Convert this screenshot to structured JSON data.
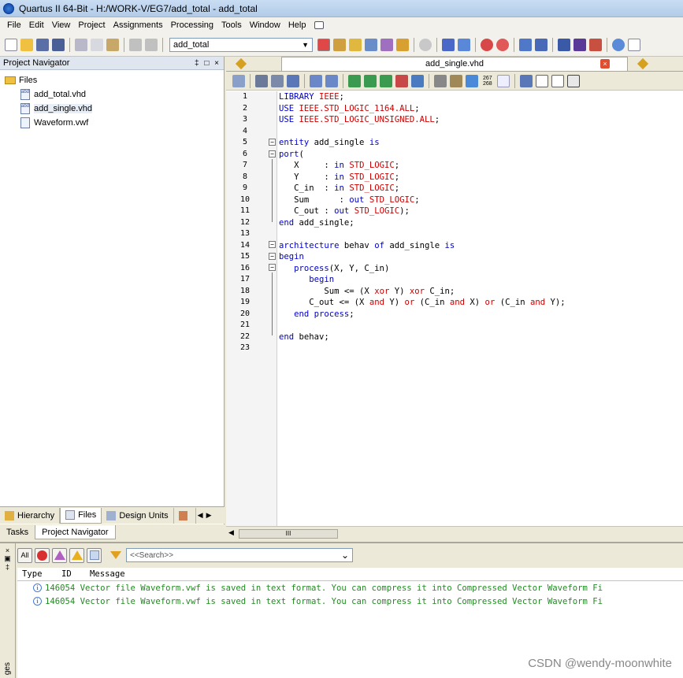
{
  "window": {
    "title": "Quartus II 64-Bit - H:/WORK-V/EG7/add_total - add_total"
  },
  "menu": [
    "File",
    "Edit",
    "View",
    "Project",
    "Assignments",
    "Processing",
    "Tools",
    "Window",
    "Help"
  ],
  "toolbar": {
    "entity_value": "add_total"
  },
  "navigator": {
    "title": "Project Navigator",
    "controls": "‡ □ ×",
    "folder": "Files",
    "files": [
      "add_total.vhd",
      "add_single.vhd",
      "Waveform.vwf"
    ],
    "file_icons": [
      "abd",
      "abd",
      ""
    ],
    "tabs": [
      "Hierarchy",
      "Files",
      "Design Units"
    ],
    "bottom_tabs": [
      "Tasks",
      "Project Navigator"
    ]
  },
  "editor": {
    "tab_label": "add_single.vhd",
    "counter_top": "267",
    "counter_bottom": "268",
    "line_numbers": [
      "1",
      "2",
      "3",
      "4",
      "5",
      "6",
      "7",
      "8",
      "9",
      "10",
      "11",
      "12",
      "13",
      "14",
      "15",
      "16",
      "17",
      "18",
      "19",
      "20",
      "21",
      "22",
      "23"
    ],
    "scroll_marker": "III"
  },
  "code": [
    [
      {
        "t": "LIBRARY ",
        "c": "kw"
      },
      {
        "t": "IEEE",
        "c": "rd"
      },
      {
        "t": ";",
        "c": ""
      }
    ],
    [
      {
        "t": "USE ",
        "c": "kw"
      },
      {
        "t": "IEEE.STD_LOGIC_1164.ALL",
        "c": "rd"
      },
      {
        "t": ";",
        "c": ""
      }
    ],
    [
      {
        "t": "USE ",
        "c": "kw"
      },
      {
        "t": "IEEE.STD_LOGIC_UNSIGNED.ALL",
        "c": "rd"
      },
      {
        "t": ";",
        "c": ""
      }
    ],
    [],
    [
      {
        "t": "entity ",
        "c": "kw"
      },
      {
        "t": "add_single ",
        "c": ""
      },
      {
        "t": "is",
        "c": "kw"
      }
    ],
    [
      {
        "t": "port",
        "c": "kw"
      },
      {
        "t": "(",
        "c": ""
      }
    ],
    [
      {
        "t": "   X     : ",
        "c": ""
      },
      {
        "t": "in ",
        "c": "kw"
      },
      {
        "t": "STD_LOGIC",
        "c": "rd"
      },
      {
        "t": ";",
        "c": ""
      }
    ],
    [
      {
        "t": "   Y     : ",
        "c": ""
      },
      {
        "t": "in ",
        "c": "kw"
      },
      {
        "t": "STD_LOGIC",
        "c": "rd"
      },
      {
        "t": ";",
        "c": ""
      }
    ],
    [
      {
        "t": "   C_in  : ",
        "c": ""
      },
      {
        "t": "in ",
        "c": "kw"
      },
      {
        "t": "STD_LOGIC",
        "c": "rd"
      },
      {
        "t": ";",
        "c": ""
      }
    ],
    [
      {
        "t": "   Sum      : ",
        "c": ""
      },
      {
        "t": "out ",
        "c": "kw"
      },
      {
        "t": "STD_LOGIC",
        "c": "rd"
      },
      {
        "t": ";",
        "c": ""
      }
    ],
    [
      {
        "t": "   C_out : ",
        "c": ""
      },
      {
        "t": "out ",
        "c": "kw"
      },
      {
        "t": "STD_LOGIC",
        "c": "rd"
      },
      {
        "t": ");",
        "c": ""
      }
    ],
    [
      {
        "t": "end ",
        "c": "kw"
      },
      {
        "t": "add_single;",
        "c": ""
      }
    ],
    [],
    [
      {
        "t": "architecture ",
        "c": "kw"
      },
      {
        "t": "behav ",
        "c": ""
      },
      {
        "t": "of ",
        "c": "kw"
      },
      {
        "t": "add_single ",
        "c": ""
      },
      {
        "t": "is",
        "c": "kw"
      }
    ],
    [
      {
        "t": "begin",
        "c": "kw"
      }
    ],
    [
      {
        "t": "   process",
        "c": "kw"
      },
      {
        "t": "(X, Y, C_in)",
        "c": ""
      }
    ],
    [
      {
        "t": "      begin",
        "c": "kw"
      }
    ],
    [
      {
        "t": "         Sum <= (X ",
        "c": ""
      },
      {
        "t": "xor ",
        "c": "rd"
      },
      {
        "t": "Y) ",
        "c": ""
      },
      {
        "t": "xor ",
        "c": "rd"
      },
      {
        "t": "C_in;",
        "c": ""
      }
    ],
    [
      {
        "t": "      C_out <= (X ",
        "c": ""
      },
      {
        "t": "and ",
        "c": "rd"
      },
      {
        "t": "Y) ",
        "c": ""
      },
      {
        "t": "or ",
        "c": "rd"
      },
      {
        "t": "(C_in ",
        "c": ""
      },
      {
        "t": "and ",
        "c": "rd"
      },
      {
        "t": "X) ",
        "c": ""
      },
      {
        "t": "or ",
        "c": "rd"
      },
      {
        "t": "(C_in ",
        "c": ""
      },
      {
        "t": "and ",
        "c": "rd"
      },
      {
        "t": "Y);",
        "c": ""
      }
    ],
    [
      {
        "t": "   end process",
        "c": "kw"
      },
      {
        "t": ";",
        "c": ""
      }
    ],
    [],
    [
      {
        "t": "end ",
        "c": "kw"
      },
      {
        "t": "behav;",
        "c": ""
      }
    ],
    []
  ],
  "messages": {
    "filter_all": "All",
    "search_placeholder": "<<Search>>",
    "columns": {
      "type": "Type",
      "id": "ID",
      "message": "Message"
    },
    "rows": [
      {
        "id": "146054",
        "text": "Vector file Waveform.vwf is saved in text format. You can compress it into Compressed Vector Waveform Fi"
      },
      {
        "id": "146054",
        "text": "Vector file Waveform.vwf is saved in text format. You can compress it into Compressed Vector Waveform Fi"
      }
    ],
    "side_label": "ges"
  },
  "watermark": "CSDN @wendy-moonwhite"
}
